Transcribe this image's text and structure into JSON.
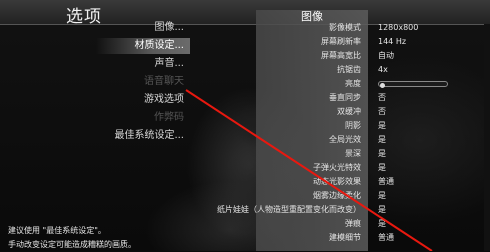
{
  "header": {
    "title": "选项"
  },
  "menu": {
    "items": [
      {
        "label": "图像...",
        "state": "normal"
      },
      {
        "label": "材质设定...",
        "state": "active"
      },
      {
        "label": "声音...",
        "state": "normal"
      },
      {
        "label": "语音聊天",
        "state": "disabled"
      },
      {
        "label": "游戏选项",
        "state": "normal"
      },
      {
        "label": "作弊码",
        "state": "disabled"
      },
      {
        "label": "最佳系统设定...",
        "state": "normal"
      }
    ]
  },
  "panel": {
    "title": "图像",
    "settings": [
      {
        "label": "影像模式",
        "value": "1280x800"
      },
      {
        "label": "屏幕刷新率",
        "value": "144 Hz"
      },
      {
        "label": "屏幕高宽比",
        "value": "自动"
      },
      {
        "label": "抗锯齿",
        "value": "4x"
      },
      {
        "label": "亮度",
        "value": ""
      },
      {
        "label": "垂直同步",
        "value": "否"
      },
      {
        "label": "双缓冲",
        "value": "否"
      },
      {
        "label": "阴影",
        "value": "是"
      },
      {
        "label": "全局光效",
        "value": "是"
      },
      {
        "label": "景深",
        "value": "是"
      },
      {
        "label": "子弹火光特效",
        "value": "是"
      },
      {
        "label": "动态光影效果",
        "value": "普通"
      },
      {
        "label": "烟雾边缘柔化",
        "value": "是"
      },
      {
        "label": "纸片娃娃（人物造型重配置变化而改变）",
        "value": "是"
      },
      {
        "label": "弹痕",
        "value": "是"
      },
      {
        "label": "建模细节",
        "value": "普通"
      }
    ],
    "brightness_level": 0.05
  },
  "footer": {
    "line1": "建议使用 \"最佳系统设定\"。",
    "line2": "手动改变设定可能造成糟糕的画质。"
  },
  "colors": {
    "annotation_arrow": "#e8180f"
  }
}
